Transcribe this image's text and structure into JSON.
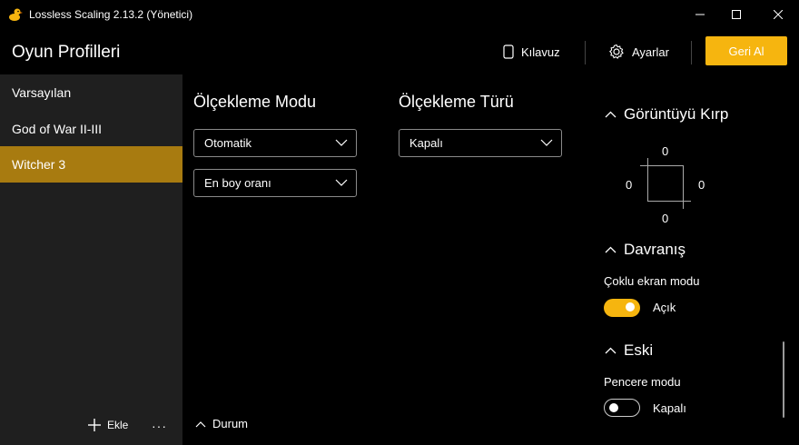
{
  "window": {
    "title": "Lossless Scaling 2.13.2 (Yönetici)",
    "icon": "duck-icon"
  },
  "header": {
    "title": "Oyun Profilleri",
    "guide_label": "Kılavuz",
    "settings_label": "Ayarlar",
    "undo_label": "Geri Al",
    "accent_color": "#f6b50f"
  },
  "sidebar": {
    "items": [
      {
        "label": "Varsayılan",
        "active": false
      },
      {
        "label": "God of War II-III",
        "active": false
      },
      {
        "label": "Witcher 3",
        "active": true
      }
    ],
    "add_label": "Ekle",
    "more_label": "···",
    "active_color": "#a87b10"
  },
  "main": {
    "scaling_mode": {
      "heading": "Ölçekleme Modu",
      "mode_value": "Otomatik",
      "aspect_value": "En boy oranı"
    },
    "scaling_type": {
      "heading": "Ölçekleme Türü",
      "value": "Kapalı"
    },
    "status_label": "Durum"
  },
  "right_panel": {
    "crop": {
      "heading": "Görüntüyü Kırp",
      "top": "0",
      "left": "0",
      "right": "0",
      "bottom": "0"
    },
    "behavior": {
      "heading": "Davranış",
      "multi_screen_label": "Çoklu ekran modu",
      "multi_screen_state": "Açık",
      "multi_screen_on": true
    },
    "legacy": {
      "heading": "Eski",
      "window_mode_label": "Pencere modu",
      "window_mode_state": "Kapalı",
      "window_mode_on": false
    }
  }
}
